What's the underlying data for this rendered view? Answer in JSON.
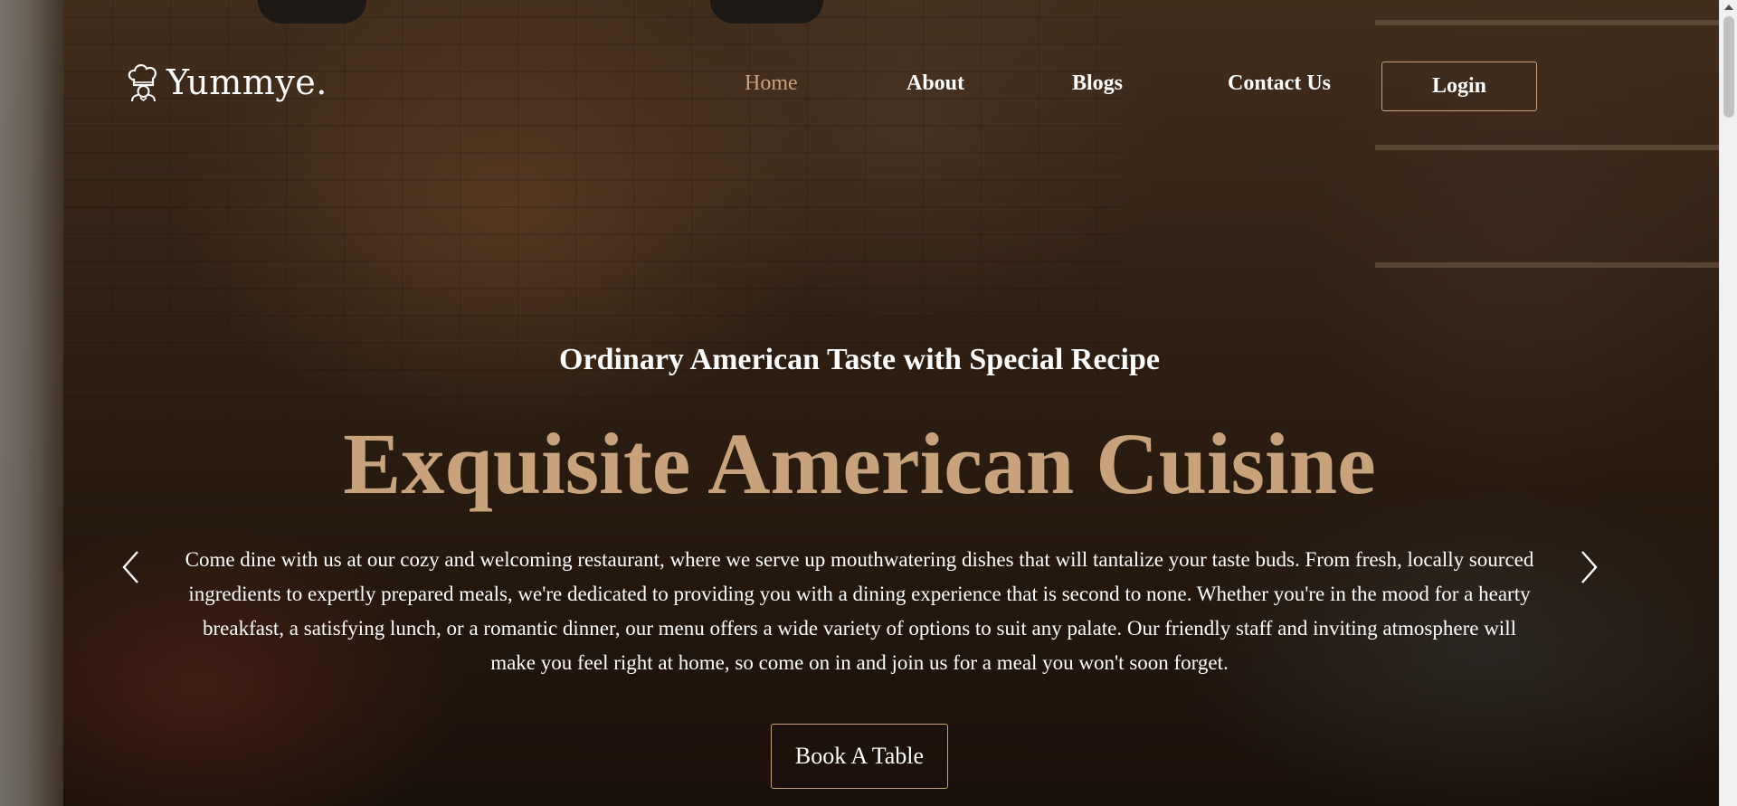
{
  "brand": {
    "name": "Yummye.",
    "logo_icon": "chef-hat-icon"
  },
  "nav": {
    "items": [
      {
        "label": "Home",
        "active": true
      },
      {
        "label": "About",
        "active": false
      },
      {
        "label": "Blogs",
        "active": false
      },
      {
        "label": "Contact Us",
        "active": false
      }
    ],
    "login_label": "Login"
  },
  "hero": {
    "subtitle": "Ordinary American Taste with Special Recipe",
    "title": "Exquisite American Cuisine",
    "description": "Come dine with us at our cozy and welcoming restaurant, where we serve up mouthwatering dishes that will tantalize your taste buds. From fresh, locally sourced ingredients to expertly prepared meals, we're dedicated to providing you with a dining experience that is second to none. Whether you're in the mood for a hearty breakfast, a satisfying lunch, or a romantic dinner, our menu offers a wide variety of options to suit any palate. Our friendly staff and inviting atmosphere will make you feel right at home, so come on in and join us for a meal you won't soon forget.",
    "cta_label": "Book A Table",
    "prev_icon": "chevron-left-icon",
    "next_icon": "chevron-right-icon"
  },
  "colors": {
    "accent": "#c7a27a",
    "text": "#ffffff"
  }
}
